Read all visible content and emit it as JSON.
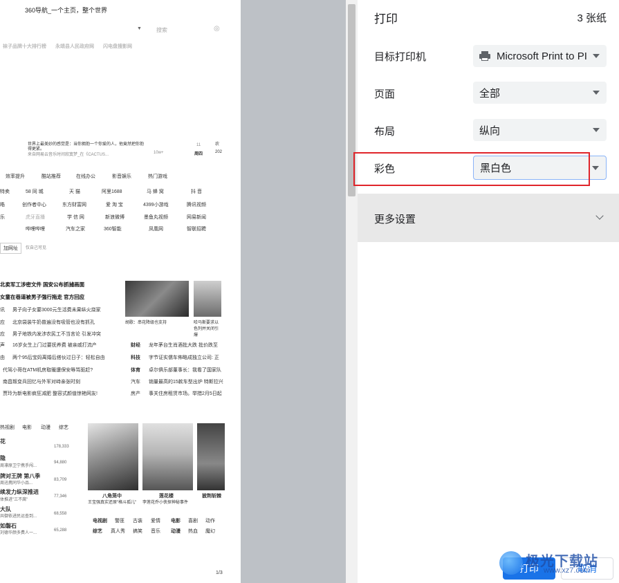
{
  "preview": {
    "header_title": "360导航_一个主页，整个世界",
    "search_label": "搜索",
    "hot_links": [
      "袜子品牌十大排行榜",
      "永靖县人民政府网",
      "闪电盘搜影网"
    ],
    "quote_line1": "世界上最美妙的感觉是：当你拥抱一个你爱的人，他竟然把你抱",
    "quote_line2": "得更紧。",
    "quote_source": "来自网易云音乐时间寂寞梦_在《CACTUS...",
    "quote_likes": "10w+",
    "cal_day": "11",
    "cal_week": "周四",
    "cal_year": "202",
    "cal_extra": "农",
    "tabs": [
      "效率提升",
      "酷站推荐",
      "在线办公",
      "影音娱乐",
      "热门游戏"
    ],
    "site_grid": [
      [
        "特卖",
        "58 同 城",
        "天 猫",
        "阿里1688",
        "马 蜂 窝",
        "抖 音"
      ],
      [
        "皓",
        "创作者中心",
        "东方财富网",
        "爱 淘 宝",
        "4399小游戏",
        "腾讯视频"
      ],
      [
        "乐",
        "虎牙直播",
        "学 信 网",
        "新浪微博",
        "墨鱼丸视频",
        "网易新闻"
      ],
      [
        "",
        "哔哩哔哩",
        "汽车之家",
        "360智能",
        "凤凰网",
        "智联招聘"
      ]
    ],
    "add_url": "加网址",
    "only_me": "仅自己可见",
    "news_headline1": "北卖军工涉密文件 国安公布抓捕画面",
    "news_headline2": "女童在巷道被男子强行拖走 官方回应",
    "news_items": [
      {
        "tag": "讯",
        "text": "男子向子女要3000元生活费未果纵火烧家"
      },
      {
        "tag": "应",
        "text": "北京袋装牛奶普遍没有吸管也没有抓孔"
      },
      {
        "tag": "应",
        "text": "男子地铁内发涉农民工不当言论 引发冲突"
      },
      {
        "tag": "声",
        "text": "16岁女生上门过要抚养费 被亲戚打流产"
      },
      {
        "tag": "由",
        "text": "两个95后宝妈离婚后搭伙过日子：轻松自由"
      },
      {
        "tag": "",
        "text": "代驾小哥在ATM机房取暖遭保安辱骂驱赶?"
      },
      {
        "tag": "",
        "text": "南昌叛变兵回忆与外军对峙亲张时刻"
      },
      {
        "tag": "",
        "text": "贾玲为新电影疯狂减肥 整容式颜值惊艳网友!"
      }
    ],
    "news_img_caption1": "胡歌：串花降级也支持",
    "news_img_caption2": "哈马斯要求以色列并关闭引爆",
    "right_news": [
      {
        "tag": "财经",
        "text": "龙年茅台生肖酒批大跌 批价跌至"
      },
      {
        "tag": "科技",
        "text": "字节证实儒车佈略成独立公司: 正"
      },
      {
        "tag": "体育",
        "text": "卓尔俱乐部董事长：我看了国家队"
      },
      {
        "tag": "汽车",
        "text": "销量最高的15款车型出炉 特斯拉兴"
      },
      {
        "tag": "房产",
        "text": "事关住房租赁市场。举措2月5日起"
      }
    ],
    "video_tabs": [
      "热视剧",
      "电影",
      "动漫",
      "综艺"
    ],
    "video_list": [
      {
        "title": "花",
        "sub": "",
        "count": "178,333"
      },
      {
        "title": "隐",
        "sub": "周凛原卫宁携手闯...",
        "count": "94,880"
      },
      {
        "title": "牌对王牌 第八季",
        "sub": "周迅携同华小品...",
        "count": "83,709"
      },
      {
        "title": "续发力纵深推进",
        "sub": "体推进\"三不腐\"",
        "count": "77,346"
      },
      {
        "title": "大队",
        "sub": "共御依进民运查到...",
        "count": "68,558"
      },
      {
        "title": "如磐石",
        "sub": "刘德华颜多费人一...",
        "count": "65,288"
      }
    ],
    "posters": [
      {
        "title": "八角笼中",
        "sub": "王宝强真实还原\"格斗孤儿\""
      },
      {
        "title": "莲花楼",
        "sub": "李莲花乔小侠探神秘事件"
      },
      {
        "title": "披荆斩棘",
        "sub": ""
      }
    ],
    "genre_row1": [
      "电视剧",
      "警匪",
      "古装",
      "爱情",
      "电影",
      "喜剧",
      "动作"
    ],
    "genre_row2": [
      "综艺",
      "真人秀",
      "搞笑",
      "音乐",
      "动漫",
      "热血",
      "魔幻"
    ],
    "page_num": "1/3"
  },
  "panel": {
    "title": "打印",
    "sheet_count": "3 张纸",
    "printer_label": "目标打印机",
    "printer_value": "Microsoft Print to PI",
    "pages_label": "页面",
    "pages_value": "全部",
    "layout_label": "布局",
    "layout_value": "纵向",
    "color_label": "彩色",
    "color_value": "黑白色",
    "more_settings": "更多设置",
    "print_button": "打印",
    "cancel_button": "取消"
  },
  "watermark": {
    "text": "极光下载站",
    "url": "www.xz7.com"
  },
  "colors": {
    "accent": "#1a73e8",
    "highlight_box": "#e0242a",
    "preview_bg": "#bdc1c6"
  }
}
